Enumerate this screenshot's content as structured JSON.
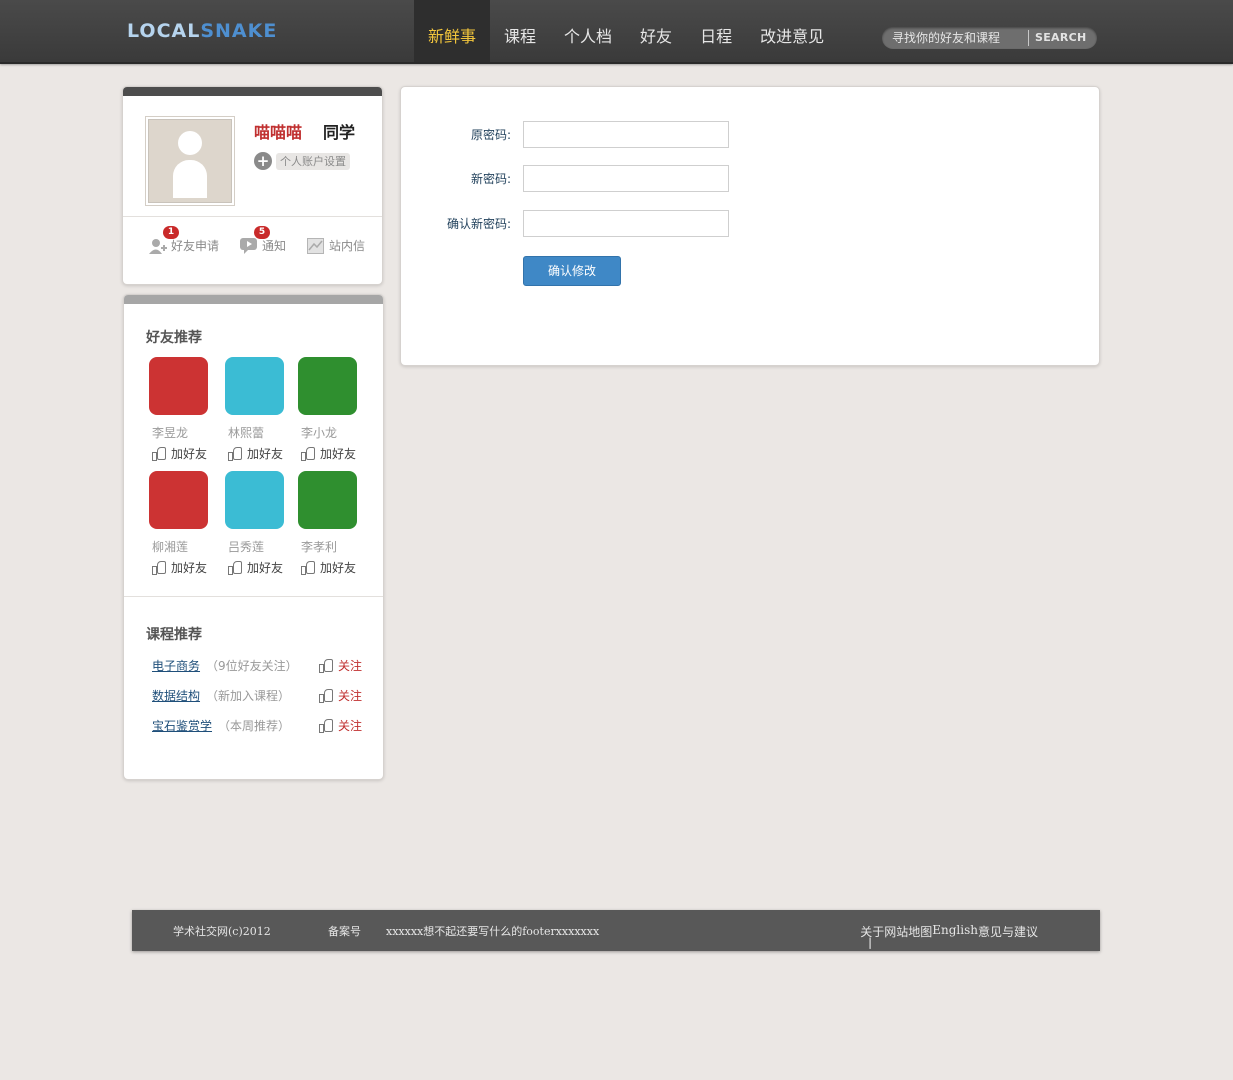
{
  "header": {
    "logo_part1": "LOCAL",
    "logo_part2": "SNAKE",
    "nav": [
      "新鲜事",
      "课程",
      "个人档",
      "好友",
      "日程",
      "改进意见"
    ],
    "active_nav": "新鲜事",
    "search_placeholder": "寻找你的好友和课程",
    "search_button": "SEARCH"
  },
  "profile": {
    "name": "喵喵喵",
    "title": "同学",
    "settings_label": "个人账户设置",
    "notifications": [
      {
        "label": "好友申请",
        "badge": "1",
        "icon": "add-friend-icon"
      },
      {
        "label": "通知",
        "badge": "5",
        "icon": "play-bubble-icon"
      },
      {
        "label": "站内信",
        "badge": "",
        "icon": "mail-icon"
      }
    ]
  },
  "friends": {
    "title": "好友推荐",
    "add_label": "加好友",
    "items": [
      {
        "name": "李昱龙",
        "color": "#cc3333"
      },
      {
        "name": "林熙蕾",
        "color": "#3bbcd4"
      },
      {
        "name": "李小龙",
        "color": "#2f8f2f"
      },
      {
        "name": "柳湘莲",
        "color": "#cc3333"
      },
      {
        "name": "吕秀莲",
        "color": "#3bbcd4"
      },
      {
        "name": "李孝利",
        "color": "#2f8f2f"
      }
    ]
  },
  "courses": {
    "title": "课程推荐",
    "follow_label": "关注",
    "items": [
      {
        "name": "电子商务",
        "note": "（9位好友关注）"
      },
      {
        "name": "数据结构",
        "note": "（新加入课程）"
      },
      {
        "name": "宝石鉴赏学",
        "note": "（本周推荐）"
      }
    ]
  },
  "form": {
    "old_label": "原密码:",
    "new_label": "新密码:",
    "confirm_label": "确认新密码:",
    "submit": "确认修改"
  },
  "footer": {
    "copyright": "学术社交网(c)2012",
    "record": "备案号",
    "text": "xxxxxx想不起还要写什么的footerxxxxxxx",
    "links": [
      "关于",
      "网站地图",
      "English",
      "意见与建议"
    ]
  },
  "colors": {
    "accent": "#f2c53c",
    "button": "#3f88c6",
    "name_red": "#c03030"
  }
}
